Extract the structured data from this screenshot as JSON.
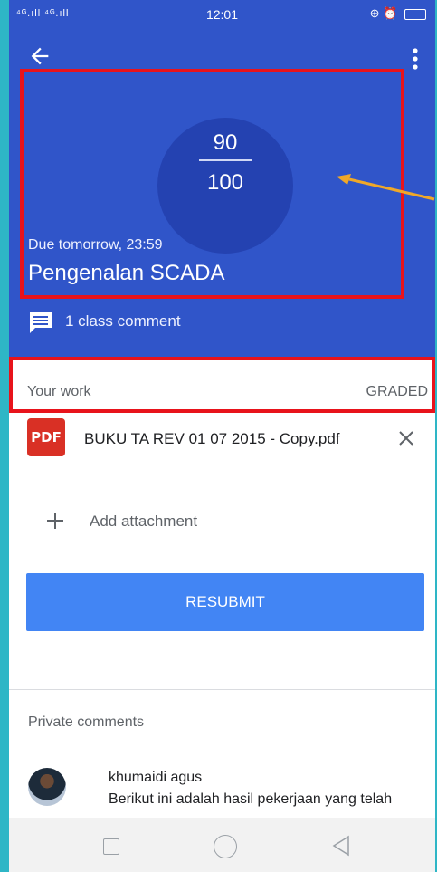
{
  "status_bar": {
    "signal": "⁴ᴳ.ıll ⁴ᴳ.ıll",
    "time": "12:01",
    "icons": "⊕ ⏰"
  },
  "grade": {
    "score": "90",
    "total": "100"
  },
  "assignment": {
    "due": "Due tomorrow, 23:59",
    "title": "Pengenalan SCADA",
    "class_comments": "1 class comment"
  },
  "work": {
    "label": "Your work",
    "status": "GRADED",
    "attachment": "BUKU TA REV 01 07 2015 - Copy.pdf",
    "attachment_type": "PDF",
    "add_attachment": "Add attachment",
    "resubmit": "RESUBMIT"
  },
  "private_comments": {
    "label": "Private comments",
    "items": [
      {
        "author": "khumaidi agus",
        "text": "Berikut ini adalah hasil pekerjaan yang telah"
      }
    ]
  },
  "colors": {
    "header": "#3055c9",
    "circle": "#2442b1",
    "button": "#4285f4",
    "highlight": "#e8131b",
    "arrow": "#f0a828"
  }
}
